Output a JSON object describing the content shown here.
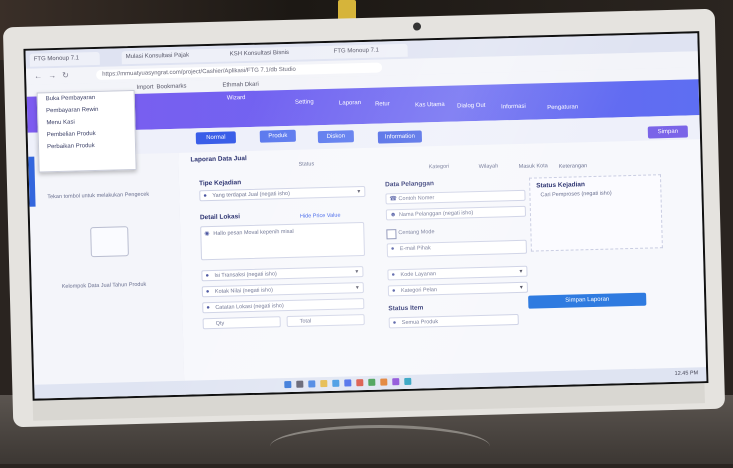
{
  "browser": {
    "tabs": [
      "FTG Monoup 7.1",
      "Mulasi Konsultasi Pajak",
      "KSH Konsultasi Bisnis",
      "FTG Monoup 7.1"
    ],
    "url": "https://mmuatyuasyngrat.com/project/Cashier/Aplikasi/FTG 7.1/db Studio",
    "bookmarks": [
      "Import",
      "Bookmarks",
      "Ethmah Dkari"
    ],
    "context_menu": [
      "Buka Pembayaran",
      "Pembayaran Rewin",
      "Menu Kasi",
      "Pembelian Produk",
      "Perbaikan Produk"
    ]
  },
  "app": {
    "toolbar": [
      "Wizard",
      "Setting",
      "Laporan",
      "Retur",
      "Kas Utama",
      "Dialog Out",
      "Informasi",
      "Pengaturan"
    ],
    "buttons": [
      "Normal",
      "Produk",
      "Diskon",
      "Information"
    ],
    "panel_title": "Laporan Data Jual",
    "sidebar_caption": "Tekan tombol untuk melakukan Pengecek",
    "sidebar_file": "Kelompok Data Jual Tahun Produk",
    "section_tipe": "Tipe Kejadian",
    "tipe_value": "Yang terdapat Jual (negati isho)",
    "section_detail": "Detail Lokasi",
    "detail_link": "Hide Price Value",
    "detail_placeholder": "Hallo pesan Moval kepenih misal",
    "dropdowns": [
      "Isi Transaksi (negati isho)",
      "Kotak Nilai (negati isho)",
      "Catatan Lokasi (negati isho)"
    ],
    "small_fields": [
      "Qty",
      "Total"
    ],
    "section_data": "Data Pelanggan",
    "phone_placeholder": "Contoh Nomer",
    "name_placeholder": "Nama Pelanggan (negati isho)",
    "checkbox_label": "Centang Mode",
    "email_placeholder": "E-mail Pihak",
    "select2": "Kode Layanan",
    "select3": "Kategori Pelan",
    "section_status": "Status Item",
    "status_value": "Semua Produk",
    "column_labels": [
      "Status",
      "Kategori",
      "Wilayah",
      "Masuk Kota",
      "Keterangan"
    ],
    "right_panel_title": "Status Kejadian",
    "right_panel_item": "Cari Pemproses (negati isho)",
    "submit": "Simpan Laporan",
    "header_title": "Simpan Laporan",
    "tray_time": "12.45  PM"
  },
  "colors": {
    "accent": "#3a5ee8",
    "header_gradient_start": "#7d5cf0",
    "header_gradient_end": "#5e6ef2",
    "submit": "#2f7be0"
  }
}
